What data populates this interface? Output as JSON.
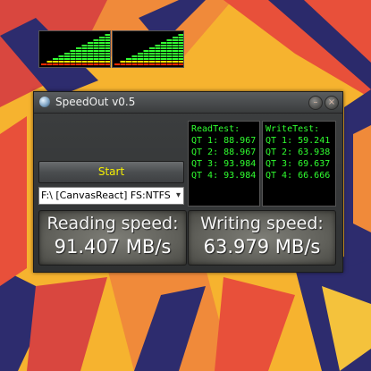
{
  "window": {
    "title": "SpeedOut v0.5"
  },
  "title_buttons": {
    "minimize_glyph": "–",
    "close_glyph": "×"
  },
  "equalizers": {
    "left_levels": [
      1,
      2,
      3,
      4,
      5,
      6,
      7,
      8,
      9,
      10,
      11,
      12
    ],
    "right_levels": [
      1,
      2,
      3,
      4,
      5,
      6,
      7,
      8,
      9,
      10,
      11,
      12
    ],
    "max_level": 12,
    "colors": {
      "low": "#ff2a00",
      "mid": "#ffe600",
      "high": "#33ff33"
    }
  },
  "controls": {
    "start_label": "Start",
    "drive_selected": "F:\\ [CanvasReact] FS:NTFS"
  },
  "read_test": {
    "header": "ReadTest:",
    "lines": [
      "QT 1: 88.967",
      "QT 2: 88.967",
      "QT 3: 93.984",
      "QT 4: 93.984"
    ]
  },
  "write_test": {
    "header": "WriteTest:",
    "lines": [
      "QT 1: 59.241",
      "QT 2: 63.938",
      "QT 3: 69.637",
      "QT 4: 66.666"
    ]
  },
  "reading": {
    "label": "Reading speed:",
    "value": "91.407 MB/s"
  },
  "writing": {
    "label": "Writing speed:",
    "value": "63.979 MB/s"
  }
}
